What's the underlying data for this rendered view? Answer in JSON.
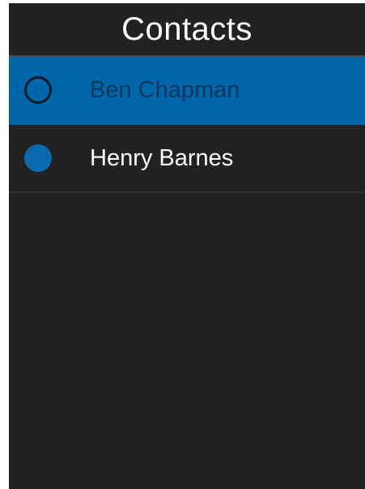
{
  "header": {
    "title": "Contacts"
  },
  "colors": {
    "background": "#222222",
    "selected_row": "#0066aa",
    "radio_filled": "#0a6ab0",
    "text": "#ffffff",
    "selected_text": "#11385a"
  },
  "contacts": [
    {
      "name": "Ben Chapman",
      "selected": true,
      "radio": "empty-circle-icon"
    },
    {
      "name": "Henry Barnes",
      "selected": false,
      "radio": "filled-circle-icon"
    }
  ]
}
